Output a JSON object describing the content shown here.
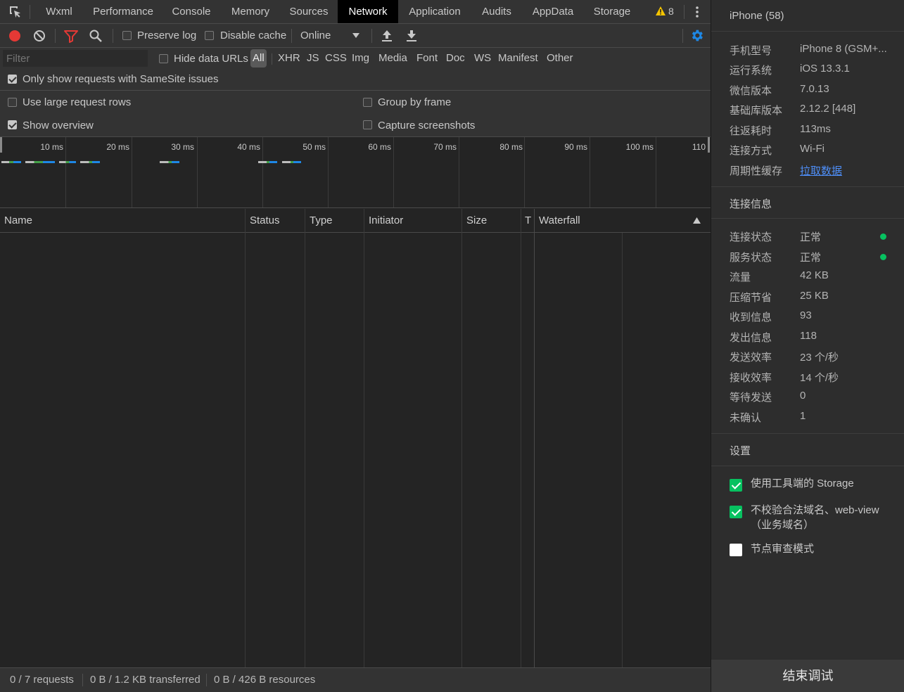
{
  "tabs": [
    {
      "label": "Wxml"
    },
    {
      "label": "Performance"
    },
    {
      "label": "Console"
    },
    {
      "label": "Memory"
    },
    {
      "label": "Sources"
    },
    {
      "label": "Network"
    },
    {
      "label": "Application"
    },
    {
      "label": "Audits"
    },
    {
      "label": "AppData"
    },
    {
      "label": "Storage"
    }
  ],
  "active_tab": "Network",
  "warnings_count": "8",
  "toolbar": {
    "preserve_log": "Preserve log",
    "disable_cache": "Disable cache",
    "throttling": "Online"
  },
  "filter": {
    "placeholder": "Filter",
    "hide_data_urls": "Hide data URLs",
    "types": [
      "All",
      "XHR",
      "JS",
      "CSS",
      "Img",
      "Media",
      "Font",
      "Doc",
      "WS",
      "Manifest",
      "Other"
    ],
    "samesite": "Only show requests with SameSite issues"
  },
  "settings": {
    "large_rows": "Use large request rows",
    "group_by_frame": "Group by frame",
    "show_overview": "Show overview",
    "capture_screenshots": "Capture screenshots"
  },
  "overview": {
    "ticks": [
      "10 ms",
      "20 ms",
      "30 ms",
      "40 ms",
      "50 ms",
      "60 ms",
      "70 ms",
      "80 ms",
      "90 ms",
      "100 ms",
      "110"
    ]
  },
  "columns": [
    "Name",
    "Status",
    "Type",
    "Initiator",
    "Size",
    "T",
    "Waterfall"
  ],
  "status": {
    "requests": "0 / 7 requests",
    "transferred": "0 B / 1.2 KB transferred",
    "resources": "0 B / 426 B resources"
  },
  "panel": {
    "device_title": "iPhone (58)",
    "device_info": [
      {
        "key": "手机型号",
        "value": "iPhone 8 (GSM+..."
      },
      {
        "key": "运行系统",
        "value": "iOS 13.3.1"
      },
      {
        "key": "微信版本",
        "value": "7.0.13"
      },
      {
        "key": "基础库版本",
        "value": "2.12.2 [448]"
      },
      {
        "key": "往返耗时",
        "value": "113ms"
      },
      {
        "key": "连接方式",
        "value": "Wi-Fi"
      },
      {
        "key": "周期性缓存",
        "value": "拉取数据"
      }
    ],
    "conn_title": "连接信息",
    "conn_info": [
      {
        "key": "连接状态",
        "value": "正常"
      },
      {
        "key": "服务状态",
        "value": "正常"
      },
      {
        "key": "流量",
        "value": "42 KB"
      },
      {
        "key": "压缩节省",
        "value": "25 KB"
      },
      {
        "key": "收到信息",
        "value": "93"
      },
      {
        "key": "发出信息",
        "value": "118"
      },
      {
        "key": "发送效率",
        "value": "23 个/秒"
      },
      {
        "key": "接收效率",
        "value": "14 个/秒"
      },
      {
        "key": "等待发送",
        "value": "0"
      },
      {
        "key": "未确认",
        "value": "1"
      }
    ],
    "settings_title": "设置",
    "settings_items": [
      {
        "label": "使用工具端的 Storage",
        "checked": true
      },
      {
        "label": "不校验合法域名、web-view（业务域名）",
        "checked": true
      },
      {
        "label": "节点审查模式",
        "checked": false
      }
    ],
    "end_button": "结束调试",
    "accent_color": "#07c160",
    "link_color": "#4e8ef7"
  }
}
